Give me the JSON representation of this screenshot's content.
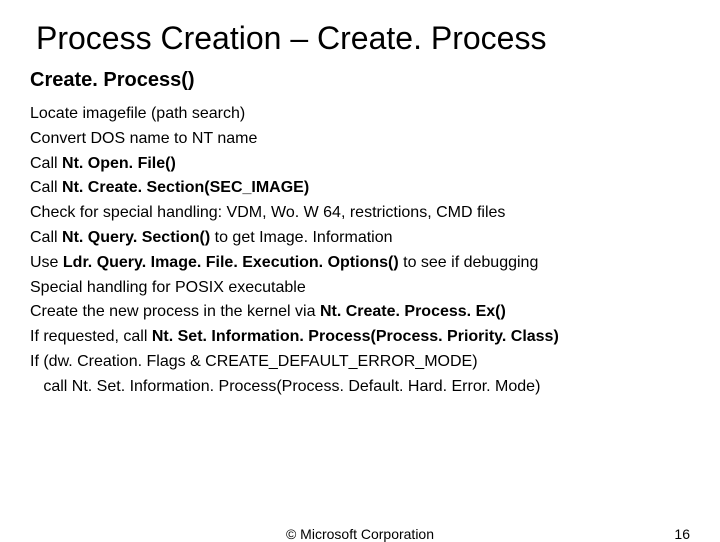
{
  "title": "Process Creation – Create. Process",
  "subtitle": "Create. Process()",
  "lines": [
    {
      "pre": "Locate imagefile (path search)",
      "bold": "",
      "post": ""
    },
    {
      "pre": "Convert DOS name to NT name",
      "bold": "",
      "post": ""
    },
    {
      "pre": "Call ",
      "bold": "Nt. Open. File()",
      "post": ""
    },
    {
      "pre": "Call ",
      "bold": "Nt. Create. Section(SEC_IMAGE)",
      "post": ""
    },
    {
      "pre": "Check for special handling: VDM, Wo. W 64, restrictions, CMD files",
      "bold": "",
      "post": ""
    },
    {
      "pre": "Call ",
      "bold": "Nt. Query. Section()",
      "post": " to get Image. Information"
    },
    {
      "pre": "Use ",
      "bold": "Ldr. Query. Image. File. Execution. Options()",
      "post": " to see if debugging"
    },
    {
      "pre": "Special handling for POSIX executable",
      "bold": "",
      "post": ""
    },
    {
      "pre": "Create the new process in the kernel via ",
      "bold": "Nt. Create. Process. Ex()",
      "post": ""
    },
    {
      "pre": "If requested, call ",
      "bold": "Nt. Set. Information. Process(Process. Priority. Class)",
      "post": ""
    },
    {
      "pre": "If (dw. Creation. Flags & CREATE_DEFAULT_ERROR_MODE)",
      "bold": "",
      "post": ""
    },
    {
      "pre": "   call Nt. Set. Information. Process(Process. Default. Hard. Error. Mode)",
      "bold": "",
      "post": ""
    }
  ],
  "footer": {
    "copyright": "© Microsoft Corporation",
    "page": "16"
  }
}
